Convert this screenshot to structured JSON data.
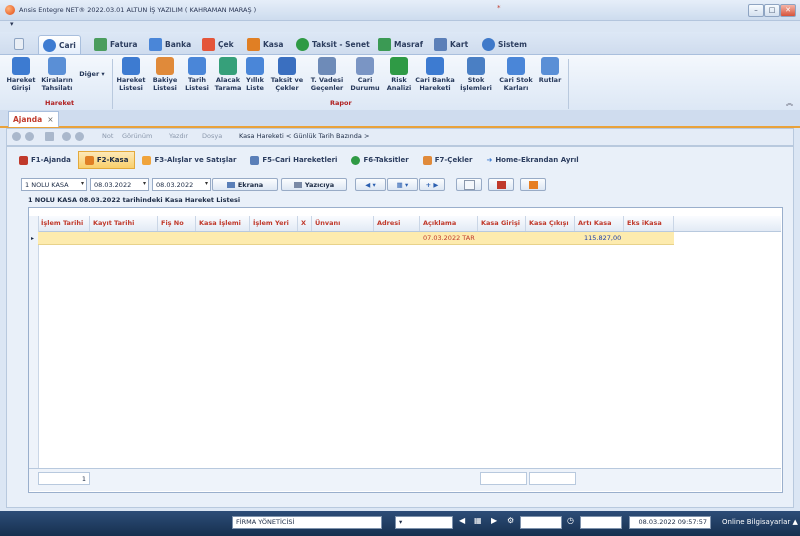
{
  "window": {
    "title": "Ansis Entegre NET® 2022.03.01 ALTUN İŞ YAZILIM ( KAHRAMAN MARAŞ )",
    "star": "*",
    "min_label": "–",
    "max_label": "□",
    "close_label": "✕"
  },
  "quick_access": "▾",
  "tabs": [
    {
      "label": "",
      "icon": "page-icon"
    },
    {
      "label": "Cari",
      "icon": "user-icon"
    },
    {
      "label": "Fatura",
      "icon": "invoice-icon"
    },
    {
      "label": "Banka",
      "icon": "bank-icon"
    },
    {
      "label": "Çek",
      "icon": "check-icon"
    },
    {
      "label": "Kasa",
      "icon": "cashbox-icon"
    },
    {
      "label": "Taksit - Senet",
      "icon": "installment-icon"
    },
    {
      "label": "Masraf",
      "icon": "expense-icon"
    },
    {
      "label": "Kart",
      "icon": "card-icon"
    },
    {
      "label": "Sistem",
      "icon": "gear-icon"
    }
  ],
  "ribbon": {
    "groups": [
      {
        "name": "Hareket",
        "buttons": [
          "Hareket Girişi",
          "Kiraların Tahsilatı",
          "Diğer"
        ]
      },
      {
        "name": "Rapor",
        "buttons": [
          "Hareket Listesi",
          "Bakiye Listesi",
          "Tarih Listesi",
          "Alacak Tarama",
          "Yıllık Liste",
          "Taksit ve Çekler",
          "T. Vadesi Geçenler",
          "Cari Durumu",
          "Risk Analizi",
          "Cari Banka Hareketi",
          "Stok İşlemleri",
          "Cari Stok Karları",
          "Rutlar"
        ]
      }
    ],
    "collapse": "︽"
  },
  "document_tab": {
    "label": "Ajanda",
    "close": "×"
  },
  "nav_toolbar": {
    "items": [
      "Not",
      "Görünüm",
      "Yazdır",
      "Dosya"
    ],
    "breadcrumb": "Kasa Hareketi < Günlük Tarih Bazında >"
  },
  "function_tabs": [
    {
      "label": "F1-Ajanda"
    },
    {
      "label": "F2-Kasa",
      "active": true
    },
    {
      "label": "F3-Alışlar ve Satışlar"
    },
    {
      "label": "F5-Cari Hareketleri"
    },
    {
      "label": "F6-Taksitler"
    },
    {
      "label": "F7-Çekler"
    },
    {
      "label": "Home-Ekrandan Ayrıl"
    }
  ],
  "filters": {
    "kasa": "1 NOLU KASA",
    "date_start": "08.03.2022",
    "date_end": "08.03.2022",
    "screen_button": "Ekrana",
    "print_button": "Yazıcıya"
  },
  "list_title": "1 NOLU KASA 08.03.2022 tarihindeki Kasa Hareket Listesi",
  "grid": {
    "columns": [
      "İşlem Tarihi",
      "Kayıt Tarihi",
      "Fiş No",
      "Kasa İşlemi",
      "İşlem Yeri",
      "X",
      "Ünvanı",
      "Adresi",
      "Açıklama",
      "Kasa Girişi",
      "Kasa Çıkışı",
      "Artı Kasa",
      "Eks iKasa"
    ],
    "rows": [
      {
        "aciklama": "07.03.2022 TAR",
        "arti_kasa": "115.827,00"
      }
    ],
    "row_indicator": "▸",
    "footer_count": "1"
  },
  "statusbar": {
    "user": "FİRMA YÖNETİCİSİ",
    "datetime": "08.03.2022  09:57:57",
    "online": "Online Bilgisayarlar"
  },
  "colors": {
    "accent_red": "#c0392b",
    "selected_row": "#fdebae",
    "active_tab": "#f9cf6b",
    "statusbar": "#1f3b5f"
  }
}
